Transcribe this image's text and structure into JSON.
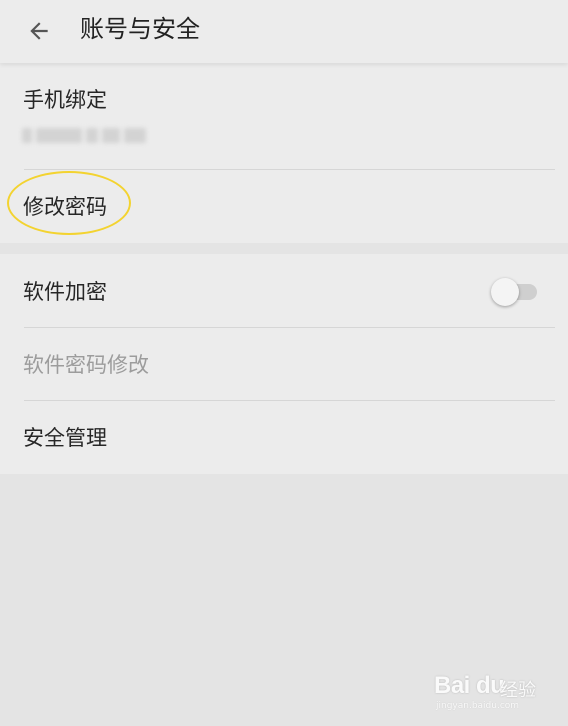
{
  "header": {
    "title": "账号与安全",
    "back_icon": "arrow-left-icon"
  },
  "account_section": {
    "phone_binding_label": "手机绑定",
    "change_password_label": "修改密码"
  },
  "security_section": {
    "software_encryption_label": "软件加密",
    "software_encryption_enabled": false,
    "software_password_change_label": "软件密码修改",
    "security_management_label": "安全管理"
  },
  "watermark": {
    "brand": "Bai du",
    "suffix": "经验",
    "url": "jingyan.baidu.com"
  },
  "colors": {
    "background": "#e4e4e4",
    "card": "#ececec",
    "highlight_ring": "#f3d330",
    "disabled_text": "#9c9c9c"
  }
}
